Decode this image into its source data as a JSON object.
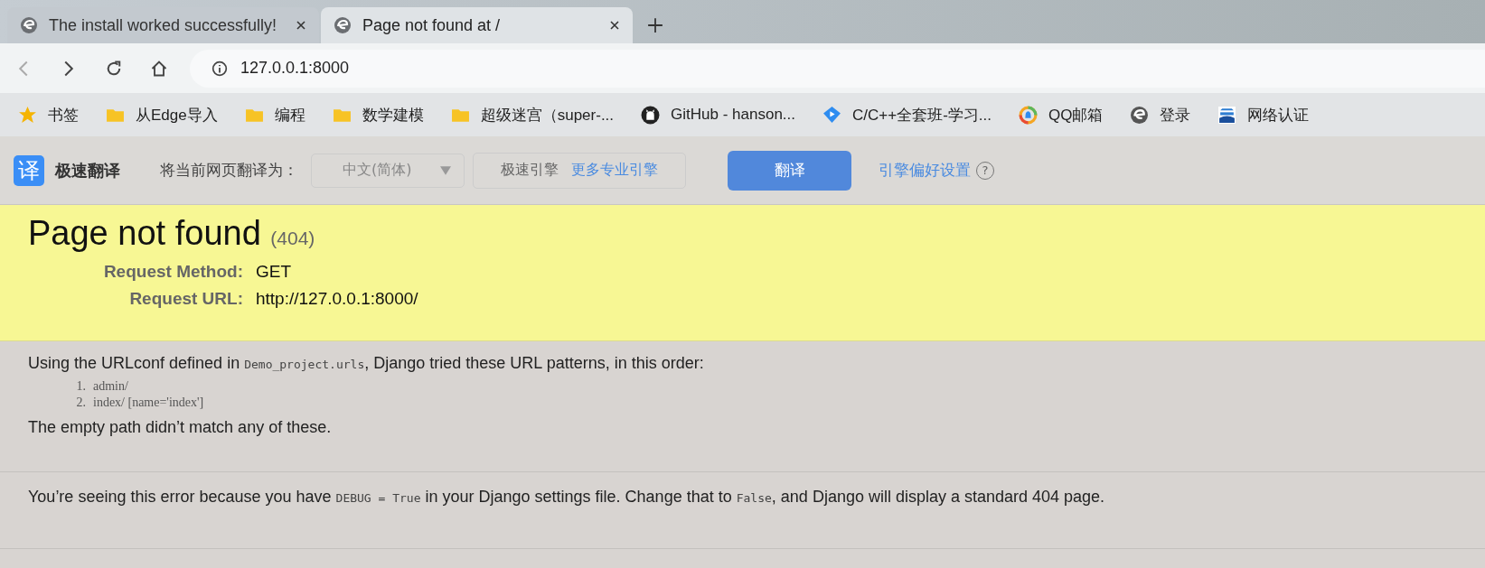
{
  "tabs": [
    {
      "title": "The install worked successfully!",
      "selected": false
    },
    {
      "title": "Page not found at /",
      "selected": true
    }
  ],
  "address_bar": {
    "url": "127.0.0.1:8000"
  },
  "bookmarks": [
    {
      "label": "书签",
      "kind": "star"
    },
    {
      "label": "从Edge导入",
      "kind": "folder"
    },
    {
      "label": "编程",
      "kind": "folder"
    },
    {
      "label": "数学建模",
      "kind": "folder"
    },
    {
      "label": "超级迷宫（super-...",
      "kind": "folder"
    },
    {
      "label": "GitHub - hanson...",
      "kind": "github"
    },
    {
      "label": "C/C++全套班-学习...",
      "kind": "play"
    },
    {
      "label": "QQ邮箱",
      "kind": "qq"
    },
    {
      "label": "登录",
      "kind": "browser"
    },
    {
      "label": "网络认证",
      "kind": "network"
    }
  ],
  "translate_bar": {
    "logo": "译",
    "title": "极速翻译",
    "prompt": "将当前网页翻译为：",
    "language": "中文(简体)",
    "engine": "极速引擎",
    "more_engines": "更多专业引擎",
    "translate_button": "翻译",
    "settings_link": "引擎偏好设置",
    "help": "?"
  },
  "summary": {
    "title": "Page not found",
    "code": "(404)",
    "fields": [
      {
        "label": "Request Method:",
        "value": "GET"
      },
      {
        "label": "Request URL:",
        "value": "http://127.0.0.1:8000/"
      }
    ]
  },
  "info": {
    "intro": [
      {
        "text": "Using the URLconf defined in ",
        "code": false
      },
      {
        "text": "Demo_project.urls",
        "code": true
      },
      {
        "text": ", Django tried these URL patterns, in this order:",
        "code": false
      }
    ],
    "patterns": [
      {
        "number": "1.",
        "text": "admin/"
      },
      {
        "number": "2.",
        "text": "index/ [name='index']"
      }
    ],
    "result": "The empty path didn’t match any of these."
  },
  "explanation": [
    {
      "text": "You’re seeing this error because you have ",
      "code": false
    },
    {
      "text": "DEBUG = True",
      "code": true
    },
    {
      "text": " in your Django settings file. Change that to ",
      "code": false
    },
    {
      "text": "False",
      "code": true
    },
    {
      "text": ", and Django will display a standard 404 page.",
      "code": false
    }
  ]
}
